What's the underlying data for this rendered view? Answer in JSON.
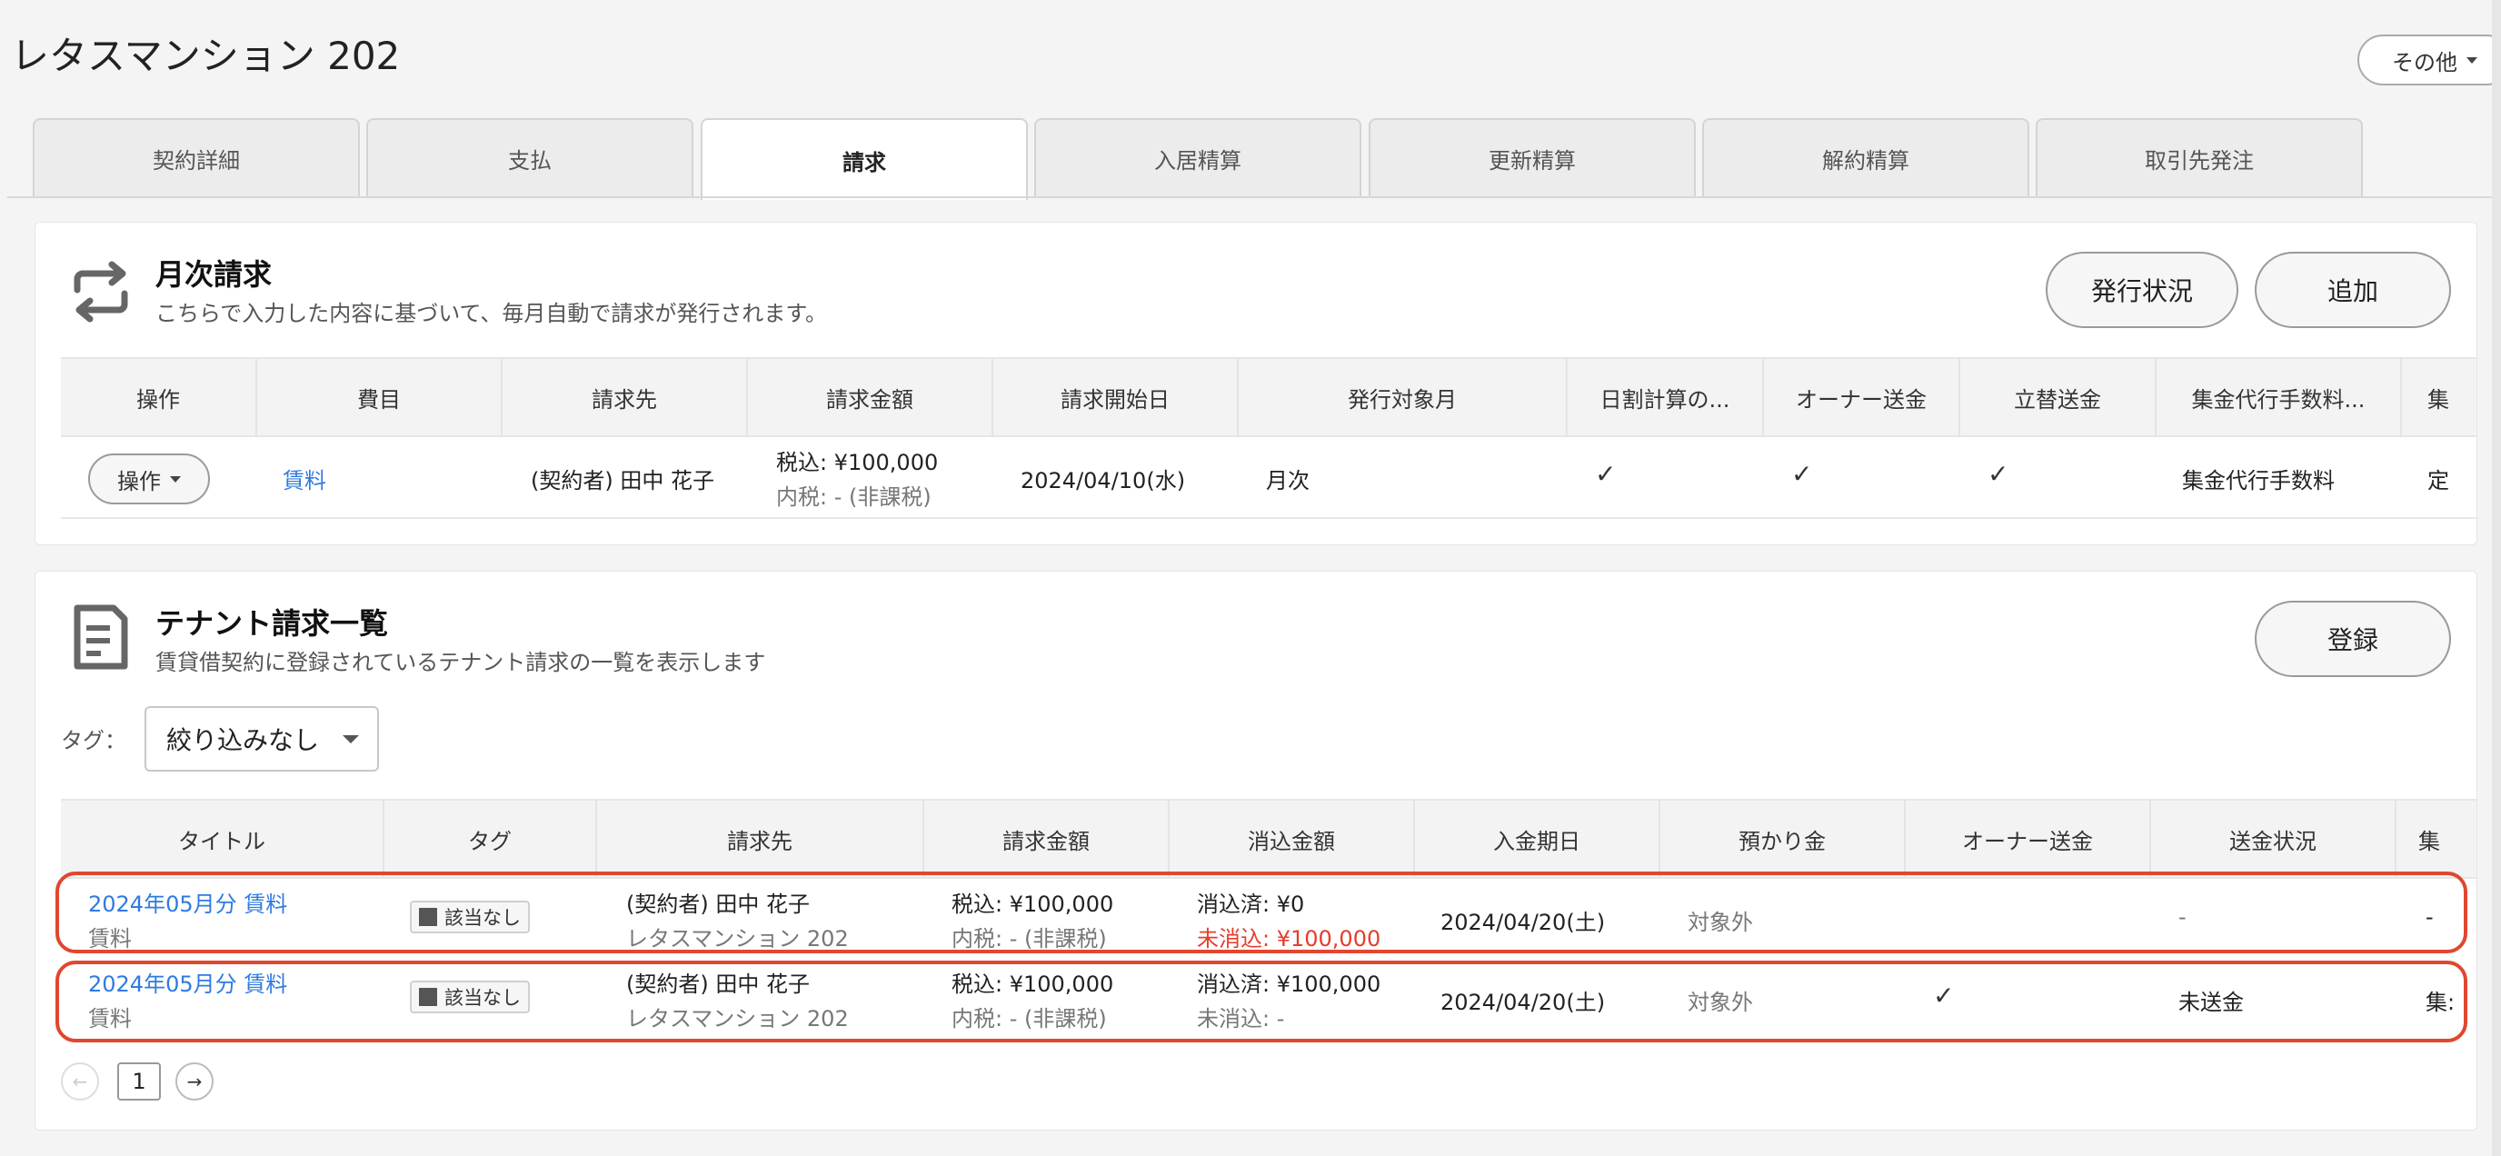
{
  "page": {
    "title": "レタスマンション 202",
    "other_label": "その他"
  },
  "tabs": [
    {
      "label": "契約詳細",
      "active": false
    },
    {
      "label": "支払",
      "active": false
    },
    {
      "label": "請求",
      "active": true
    },
    {
      "label": "入居精算",
      "active": false
    },
    {
      "label": "更新精算",
      "active": false
    },
    {
      "label": "解約精算",
      "active": false
    },
    {
      "label": "取引先発注",
      "active": false
    }
  ],
  "monthly": {
    "title": "月次請求",
    "description": "こちらで入力した内容に基づいて、毎月自動で請求が発行されます。",
    "status_button": "発行状況",
    "add_button": "追加",
    "headers": [
      "操作",
      "費目",
      "請求先",
      "請求金額",
      "請求開始日",
      "発行対象月",
      "日割計算の...",
      "オーナー送金",
      "立替送金",
      "集金代行手数料...",
      "集"
    ],
    "row": {
      "op_label": "操作",
      "item": "賃料",
      "billing_to": "(契約者) 田中 花子",
      "amount_main": "税込: ¥100,000",
      "amount_sub": "内税: - (非課税)",
      "start_date": "2024/04/10(水)",
      "target_month": "月次",
      "prorate": "✓",
      "owner_remit": "✓",
      "advance_remit": "✓",
      "fee": "集金代行手数料",
      "extra": "定"
    }
  },
  "tenant": {
    "title": "テナント請求一覧",
    "description": "賃貸借契約に登録されているテナント請求の一覧を表示します",
    "register_button": "登録",
    "tag_label": "タグ：",
    "tag_filter": "絞り込みなし",
    "headers": [
      "タイトル",
      "タグ",
      "請求先",
      "請求金額",
      "消込金額",
      "入金期日",
      "預かり金",
      "オーナー送金",
      "送金状況",
      "集"
    ],
    "rows": [
      {
        "title": "2024年05月分 賃料",
        "subtitle": "賃料",
        "tag": "該当なし",
        "billing_to": "(契約者) 田中 花子",
        "property": "レタスマンション 202",
        "amount_main": "税込: ¥100,000",
        "amount_sub": "内税: - (非課税)",
        "cleared": "消込済: ¥0",
        "uncleared": "未消込: ¥100,000",
        "due_date": "2024/04/20(土)",
        "deposit": "対象外",
        "owner_remit": "",
        "remit_status": "-",
        "extra": "-"
      },
      {
        "title": "2024年05月分 賃料",
        "subtitle": "賃料",
        "tag": "該当なし",
        "billing_to": "(契約者) 田中 花子",
        "property": "レタスマンション 202",
        "amount_main": "税込: ¥100,000",
        "amount_sub": "内税: - (非課税)",
        "cleared": "消込済: ¥100,000",
        "uncleared": "未消込: -",
        "due_date": "2024/04/20(土)",
        "deposit": "対象外",
        "owner_remit": "✓",
        "remit_status": "未送金",
        "extra": "集:"
      }
    ],
    "pagination": {
      "current": "1",
      "prev": "←",
      "next": "→"
    }
  },
  "colors": {
    "link": "#2f7be0",
    "highlight": "#e0472e",
    "uncleared_red": "#e53d2b"
  }
}
